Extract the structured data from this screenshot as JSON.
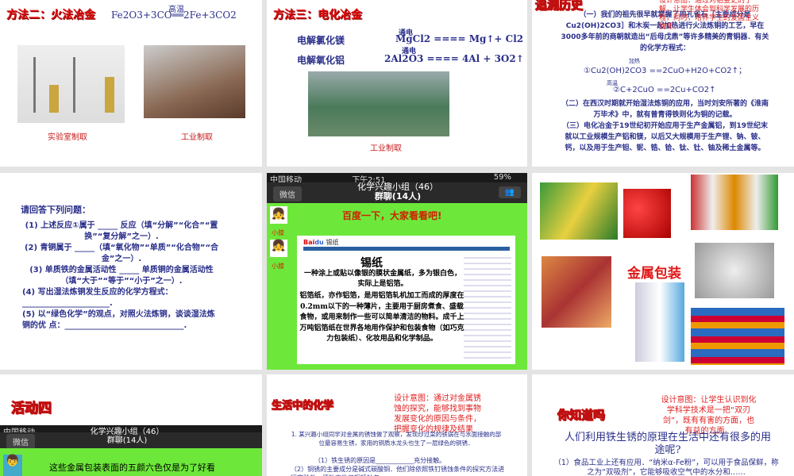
{
  "s1": {
    "title": "方法二：火法冶金",
    "equation": "Fe2O3+3CO══2Fe+3CO2",
    "condition": "高温",
    "caption_lab": "实验室制取",
    "caption_industry": "工业制取"
  },
  "s2": {
    "title": "方法三：电化冶金",
    "row1_label": "电解氯化镁",
    "row1_eq": "MgCl2 ==== Mg↑+ Cl2",
    "row1_cond": "通电",
    "row2_label": "电解氧化铝",
    "row2_eq": "2Al2O3 ==== 4Al + 3O2↑",
    "row2_cond": "通电",
    "caption": "工业制取"
  },
  "s3": {
    "title": "追溯历史",
    "note": "设计意图：通过对铝金史的了解，让学生体会到科学发展的历程，同时，培养学生的爱国主义情怀。",
    "p1": "（一）我们的祖先很早就掌握了用孔雀石［主要成分是Cu2(OH)2CO3］和木炭一起加热进行火法炼铜的工艺，早在3000多年前的商朝就造出“后母戊鼎”等许多精美的青铜器．有关的化学方程式：",
    "eq1_cond": "加热",
    "eq1": "①Cu2(OH)2CO3 ==2CuO+H2O+CO2↑；",
    "eq2_cond": "高温",
    "eq2": "②C+2CuO ==2Cu+CO2↑",
    "p2": "（二）在西汉时期就开始湿法炼铜的应用，当时刘安所著的《淮南万毕术》中，就有曾青得铁则化为铜的记载。",
    "p3": "（三）电化冶金于19世纪初开始应用于生产金属铝，到19世纪末就以工业规模生产铝和镁，以后又大规模用于生产锂、钠、铍、钙，以及用于生产钽、铌、锆、铪、钛、钍、铀及稀土金属等。"
  },
  "s4": {
    "heading": "请回答下列问题：",
    "items": [
      "(1) 上述反应①属于 _____ 反应（填“分解”“化合”“置换”“复分解”之一）.",
      "(2) 青铜属于 _____（填“氧化物”“单质”“化合物”“合金”之一）.",
      "(3) 单质铁的金属活动性 _____ 单质铜的金属活动性（填“大于”“等于”“小于”之一）.",
      "(4) 写出湿法炼铜发生反应的化学方程式：______________________.",
      "(5) 以“绿色化学”的观点，对照火法炼铜，谈谈湿法炼铜的优 点：______________________________."
    ]
  },
  "s5": {
    "status_carrier": "中国移动",
    "status_time": "下午2:51",
    "status_battery": "59%",
    "back": "微信",
    "chat_title": "化学兴趣小组（46）",
    "chat_title2": "群聊(14人)",
    "message": "百度一下，大家看看吧!",
    "sender": "小膝",
    "sender2": "小膝",
    "card_title": "锡纸",
    "card_text1": "一种涂上或贴以像银的膜状金属纸，多为银白色，实际上是铝箔。",
    "card_text2": "铝箔纸，亦作铝箔，是用铝箔轧机加工而成的厚度在0.2mm以下的一种薄片，主要用于厨房煮食、盛载食物，或用来制作一些可以简单清洁的物料。成千上万吨铝箔纸在世界各地用作保护和包装食物（如巧克力包装纸）、化妆用品和化学制品。",
    "search_term": "锡纸"
  },
  "s6": {
    "label": "金属包装"
  },
  "s7": {
    "title": "活动四",
    "status_carrier": "中国移动",
    "back": "微信",
    "chat_title": "化学兴趣小组（46）",
    "chat_title2": "群聊(14人)",
    "message": "这些金属包装表面的五颜六色仅是为了好看"
  },
  "s8": {
    "title": "生活中的化学",
    "note": "设计意图：通过对金属锈蚀的探究，能够找到事物发展变化的原因与条件，把握变化的规律及结果",
    "p1": "1. 某兴趣小组同学对金属的锈蚀做了观察，发现炒过菜的铁锅在与水面接触的部位最容易生锈，家用的铜质水龙头也生了一层绿色的铜锈．",
    "p2": "（1）铁生锈的原因是____________充分接触。",
    "p3": "（2）铜锈的主要成分是碱式碳酸铜．他们除依照铁钉锈蚀条件的探究方法进行实验外，还补充做了铜锈蚀与……"
  },
  "s9": {
    "title": "你知道吗",
    "note": "设计意图：让学生认识到化学科学技术是一把“双刃剑”，既有有害的方面，也有益的方面。",
    "question": "人们利用铁生锈的原理在生活中还有很多的用途呢?",
    "p1": "（1）食品工业上还有应用．“纳米α-Fe粉”，可以用于食品保鲜，称之为“双吸剂”，它能够吸收空气中的水分和……"
  }
}
